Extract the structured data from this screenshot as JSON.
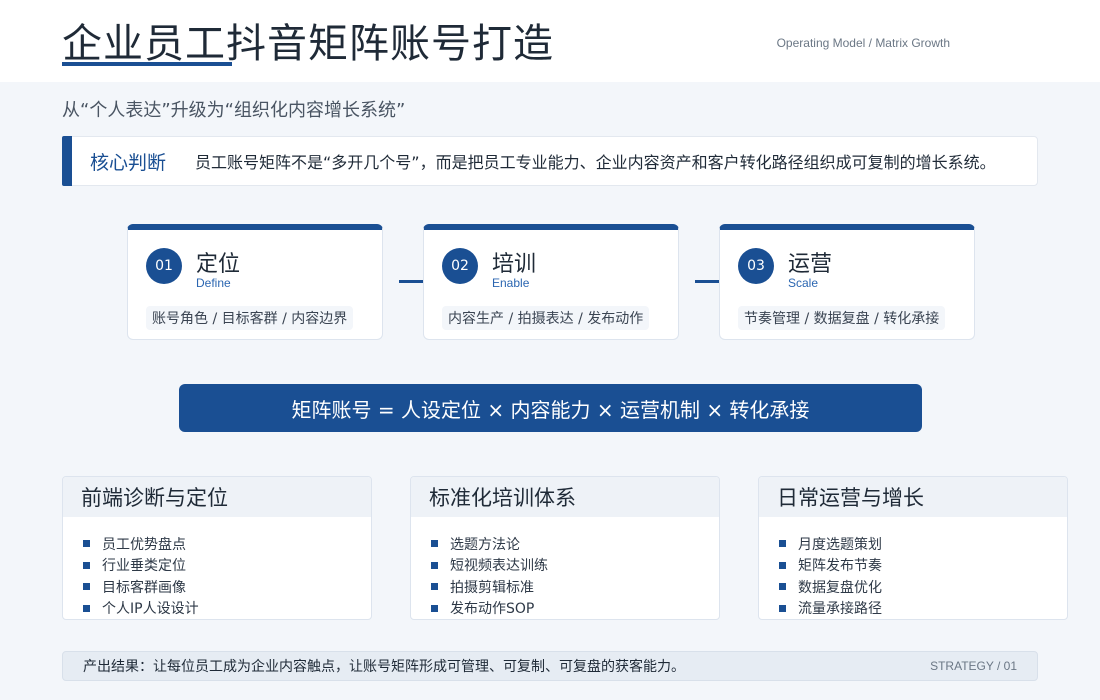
{
  "header": {
    "title": "企业员工抖音矩阵账号打造",
    "subtitle_en": "Operating Model / Matrix Growth"
  },
  "subtitle": "从“个人表达”升级为“组织化内容增长系统”",
  "judgement": {
    "label": "核心判断",
    "text": "员工账号矩阵不是“多开几个号”，而是把员工专业能力、企业内容资产和客户转化路径组织成可复制的增长系统。"
  },
  "steps": [
    {
      "num": "01",
      "title": "定位",
      "en": "Define",
      "desc": "账号角色 / 目标客群 / 内容边界"
    },
    {
      "num": "02",
      "title": "培训",
      "en": "Enable",
      "desc": "内容生产 / 拍摄表达 / 发布动作"
    },
    {
      "num": "03",
      "title": "运营",
      "en": "Scale",
      "desc": "节奏管理 / 数据复盘 / 转化承接"
    }
  ],
  "formula": "矩阵账号 = 人设定位 × 内容能力 × 运营机制 × 转化承接",
  "cards": [
    {
      "title": "前端诊断与定位",
      "items": [
        "员工优势盘点",
        "行业垂类定位",
        "目标客群画像",
        "个人IP人设设计"
      ]
    },
    {
      "title": "标准化培训体系",
      "items": [
        "选题方法论",
        "短视频表达训练",
        "拍摄剪辑标准",
        "发布动作SOP"
      ]
    },
    {
      "title": "日常运营与增长",
      "items": [
        "月度选题策划",
        "矩阵发布节奏",
        "数据复盘优化",
        "流量承接路径"
      ]
    }
  ],
  "footer": {
    "text": "产出结果：让每位员工成为企业内容触点，让账号矩阵形成可管理、可复制、可复盘的获客能力。",
    "tag": "STRATEGY / 01"
  },
  "colors": {
    "accent": "#1a4f93",
    "background": "#f3f6fa"
  }
}
